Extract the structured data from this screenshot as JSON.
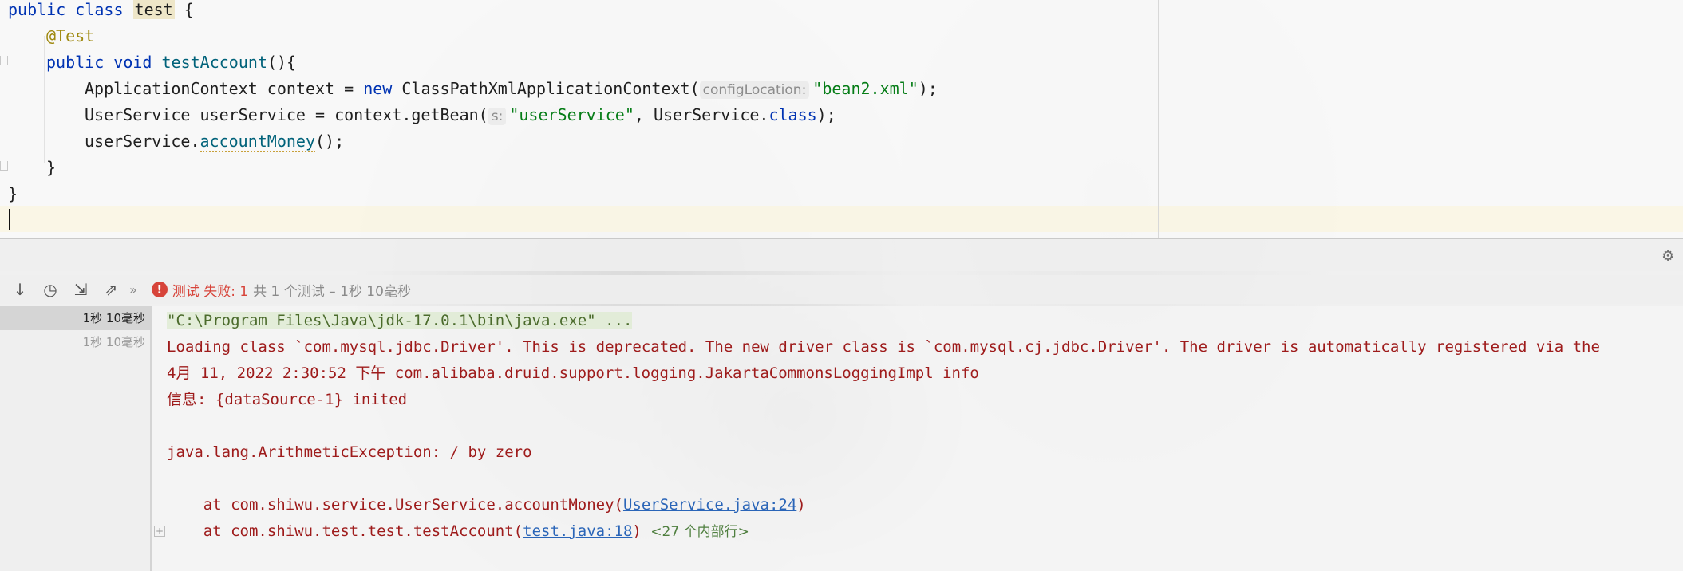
{
  "editor": {
    "line1": {
      "kw": "public class ",
      "class_name": "test",
      "rest": " {"
    },
    "line2": {
      "annotation": "@Test"
    },
    "line3": {
      "kw": "public void ",
      "method": "testAccount",
      "rest": "(){"
    },
    "line4": {
      "pre": "ApplicationContext context = ",
      "kw": "new",
      "mid": " ClassPathXmlApplicationContext(",
      "hint": "configLocation:",
      "str": "\"bean2.xml\"",
      "post": ");"
    },
    "line5": {
      "pre": "UserService userService = context.getBean(",
      "hint": "s:",
      "str": "\"userService\"",
      "mid": ", UserService.",
      "kw": "class",
      "post": ");"
    },
    "line6": {
      "pre": "userService.",
      "method": "accountMoney",
      "post": "();"
    },
    "line7": {
      "text": "}"
    },
    "line8": {
      "text": "}"
    }
  },
  "toolbar": {
    "icons": [
      "arrow-down-icon",
      "history-icon",
      "import-icon",
      "export-icon"
    ],
    "more": "»",
    "status_fail": "测试 失败: 1",
    "status_summary": "共 1 个测试 – 1秒 10毫秒"
  },
  "tree": {
    "rows": [
      "1秒 10毫秒",
      "1秒 10毫秒"
    ]
  },
  "console": {
    "cmd": "\"C:\\Program Files\\Java\\jdk-17.0.1\\bin\\java.exe\" ...",
    "line_loading": "Loading class `com.mysql.jdbc.Driver'. This is deprecated. The new driver class is `com.mysql.cj.jdbc.Driver'. The driver is automatically registered via the",
    "line_date": "4月 11, 2022 2:30:52 下午 com.alibaba.druid.support.logging.JakartaCommonsLoggingImpl info",
    "line_info": "信息: {dataSource-1} inited",
    "line_exception": "java.lang.ArithmeticException: / by zero",
    "frame1": {
      "pre": "    at com.shiwu.service.UserService.accountMoney(",
      "link": "UserService.java:24",
      "post": ")"
    },
    "frame2": {
      "pre": "    at com.shiwu.test.test.testAccount(",
      "link": "test.java:18",
      "post": ") ",
      "internal": "<27 个内部行>"
    }
  },
  "colors": {
    "error": "#d7443a",
    "link": "#2a65b8",
    "keyword": "#0033b3",
    "string": "#067d17",
    "annotation": "#9e880d"
  }
}
